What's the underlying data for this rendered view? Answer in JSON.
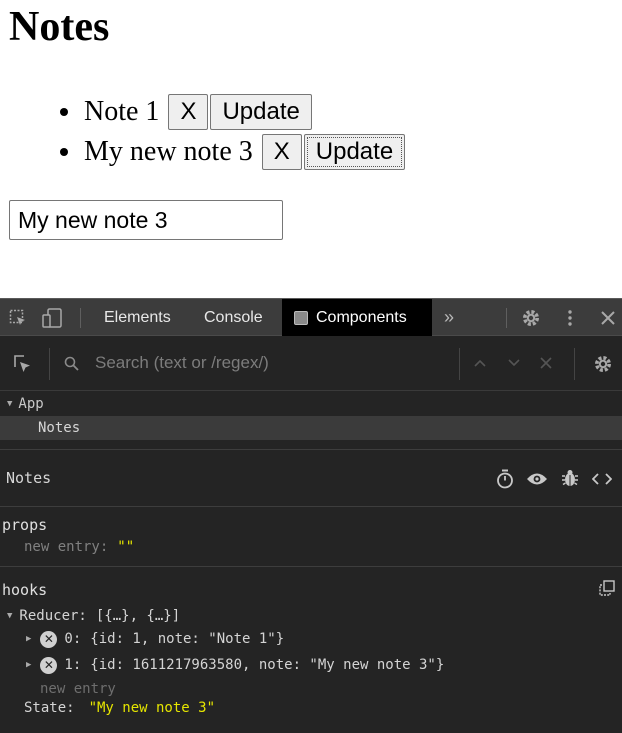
{
  "page": {
    "title": "Notes",
    "notes": [
      {
        "text": "Note 1",
        "delete_label": "X",
        "update_label": "Update"
      },
      {
        "text": "My new note 3",
        "delete_label": "X",
        "update_label": "Update"
      }
    ],
    "input_value": "My new note 3"
  },
  "devtools": {
    "tabs": {
      "elements": "Elements",
      "console": "Console",
      "components": "Components",
      "more": "»"
    },
    "search_placeholder": "Search (text or /regex/)",
    "tree": {
      "root": "App",
      "child": "Notes"
    },
    "selected_component": "Notes",
    "props": {
      "title": "props",
      "key": "new entry:",
      "value": "\"\""
    },
    "hooks": {
      "title": "hooks",
      "reducer_label": "Reducer:",
      "reducer_summary": "[{…}, {…}]",
      "entries": [
        {
          "index": "0:",
          "value": "{id: 1, note: \"Note 1\"}"
        },
        {
          "index": "1:",
          "value": "{id: 1611217963580, note: \"My new note 3\"}"
        }
      ],
      "new_entry_label": "new entry",
      "state_label": "State:",
      "state_value": "\"My new note 3\""
    },
    "icons": [
      "inspect-icon",
      "device-icon",
      "settings-icon",
      "kebab-icon",
      "close-icon",
      "stopwatch-icon",
      "eye-icon",
      "bug-icon",
      "code-icon",
      "copy-icon",
      "search-icon"
    ],
    "colors": {
      "panel_bg": "#242424",
      "tabbar_bg": "#3c3c3c",
      "string_value": "#e6e600",
      "active_tab": "#000000"
    }
  }
}
